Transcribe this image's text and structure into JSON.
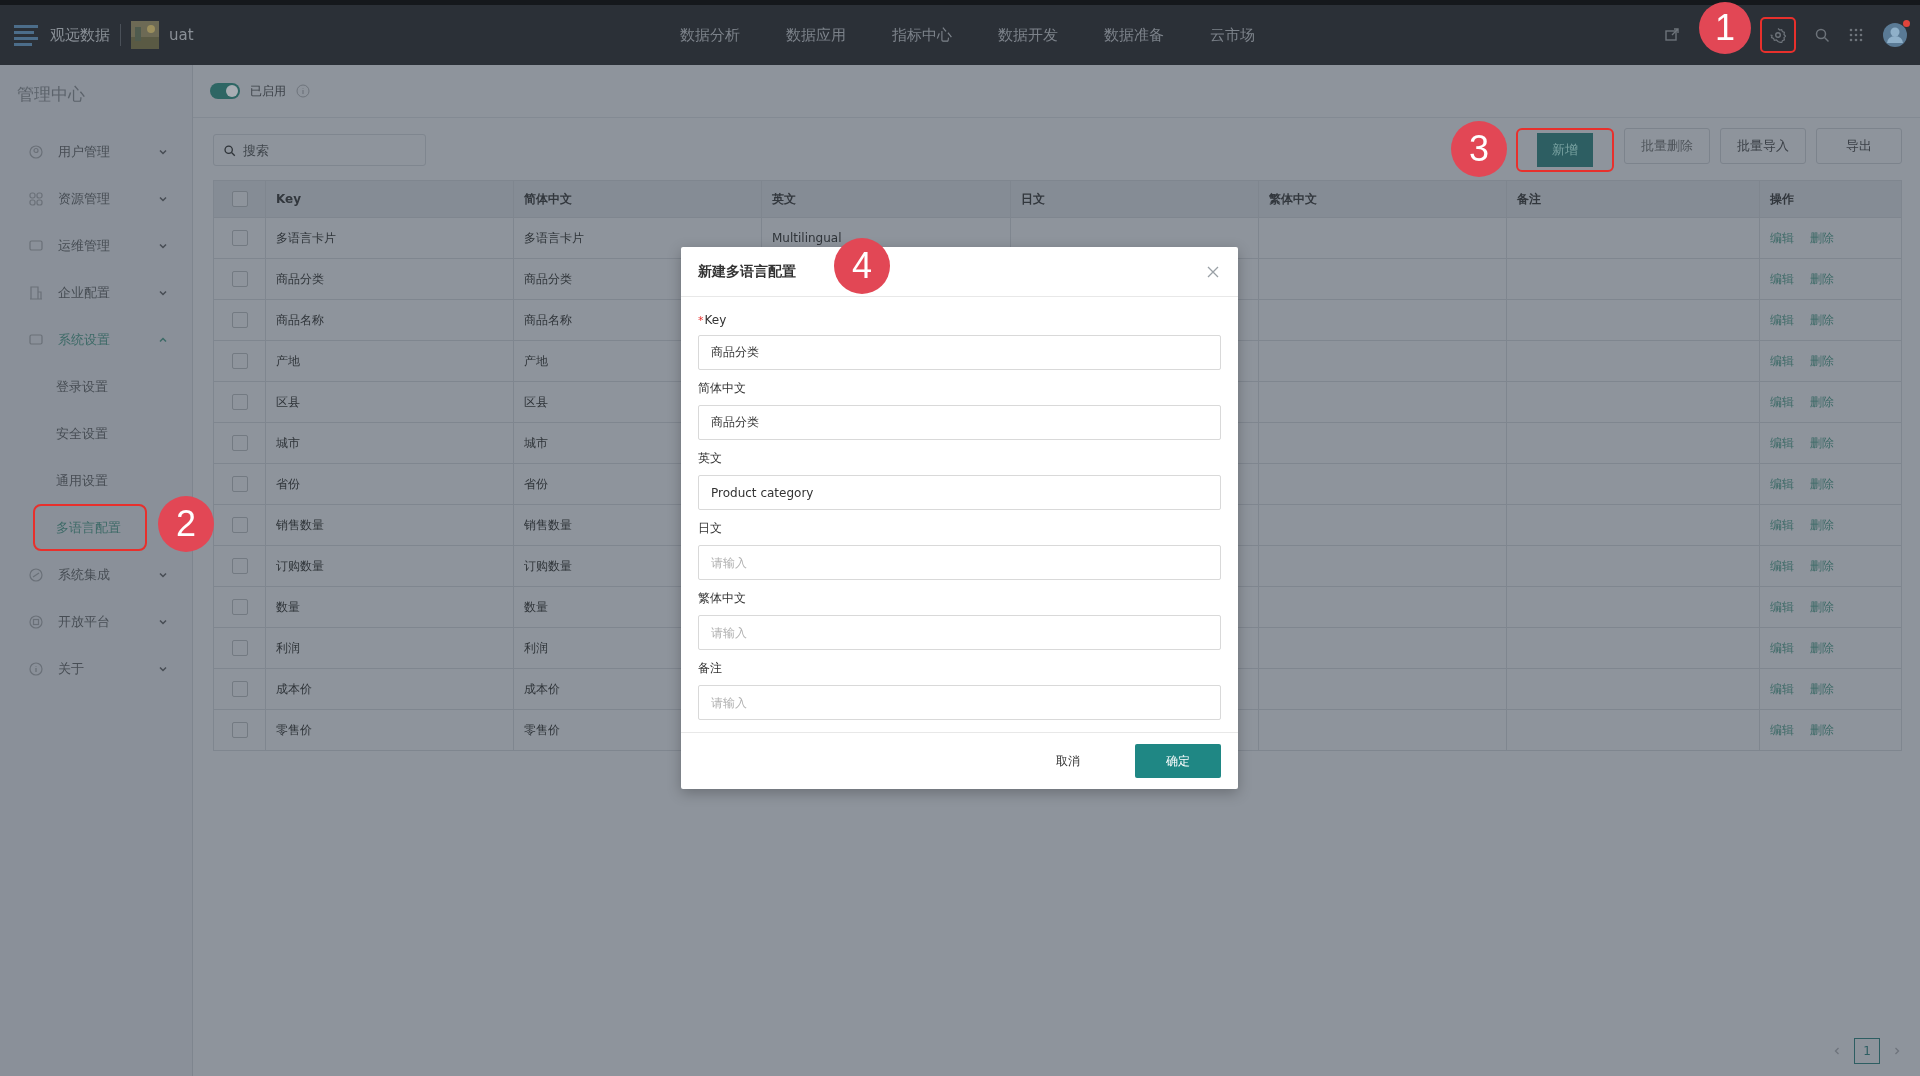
{
  "topbar": {
    "brand": "观远数据",
    "workspace": "uat",
    "nav": [
      {
        "label": "数据分析",
        "selected": false
      },
      {
        "label": "数据应用",
        "selected": false
      },
      {
        "label": "指标中心",
        "selected": false
      },
      {
        "label": "数据开发",
        "selected": false
      },
      {
        "label": "数据准备",
        "selected": false
      },
      {
        "label": "云市场",
        "selected": false
      }
    ],
    "settings_highlighted": true,
    "avatar_notification": true
  },
  "sidebar": {
    "title": "管理中心",
    "items": [
      {
        "label": "用户管理",
        "expanded": false
      },
      {
        "label": "资源管理",
        "expanded": false
      },
      {
        "label": "运维管理",
        "expanded": false
      },
      {
        "label": "企业配置",
        "expanded": false
      },
      {
        "label": "系统设置",
        "expanded": true,
        "children": [
          {
            "label": "登录设置",
            "selected": false,
            "highlighted": false
          },
          {
            "label": "安全设置",
            "selected": false,
            "highlighted": false
          },
          {
            "label": "通用设置",
            "selected": false,
            "highlighted": false
          },
          {
            "label": "多语言配置",
            "selected": true,
            "highlighted": true
          }
        ]
      },
      {
        "label": "系统集成",
        "expanded": false
      },
      {
        "label": "开放平台",
        "expanded": false
      },
      {
        "label": "关于",
        "expanded": false
      }
    ]
  },
  "toggle": {
    "label": "已启用",
    "on": true
  },
  "search": {
    "placeholder": "搜索"
  },
  "buttons": [
    {
      "label": "新增",
      "kind": "primary",
      "disabled": false,
      "highlighted": true
    },
    {
      "label": "批量删除",
      "kind": "default",
      "disabled": true,
      "highlighted": false
    },
    {
      "label": "批量导入",
      "kind": "default",
      "disabled": false,
      "highlighted": false
    },
    {
      "label": "导出",
      "kind": "default",
      "disabled": false,
      "highlighted": false
    }
  ],
  "table": {
    "columns": [
      "Key",
      "简体中文",
      "英文",
      "日文",
      "繁体中文",
      "备注",
      "操作"
    ],
    "all_checked": false,
    "rows": [
      {
        "checked": false,
        "cells": [
          "多语言卡片",
          "多语言卡片",
          "Multilingual",
          "",
          "",
          ""
        ],
        "actions": [
          "编辑",
          "删除"
        ]
      },
      {
        "checked": false,
        "cells": [
          "商品分类",
          "商品分类",
          "",
          "",
          "",
          ""
        ],
        "actions": [
          "编辑",
          "删除"
        ]
      },
      {
        "checked": false,
        "cells": [
          "商品名称",
          "商品名称",
          "",
          "",
          "",
          ""
        ],
        "actions": [
          "编辑",
          "删除"
        ]
      },
      {
        "checked": false,
        "cells": [
          "产地",
          "产地",
          "",
          "",
          "",
          ""
        ],
        "actions": [
          "编辑",
          "删除"
        ]
      },
      {
        "checked": false,
        "cells": [
          "区县",
          "区县",
          "",
          "",
          "",
          ""
        ],
        "actions": [
          "编辑",
          "删除"
        ]
      },
      {
        "checked": false,
        "cells": [
          "城市",
          "城市",
          "",
          "",
          "",
          ""
        ],
        "actions": [
          "编辑",
          "删除"
        ]
      },
      {
        "checked": false,
        "cells": [
          "省份",
          "省份",
          "",
          "",
          "",
          ""
        ],
        "actions": [
          "编辑",
          "删除"
        ]
      },
      {
        "checked": false,
        "cells": [
          "销售数量",
          "销售数量",
          "",
          "",
          "",
          ""
        ],
        "actions": [
          "编辑",
          "删除"
        ]
      },
      {
        "checked": false,
        "cells": [
          "订购数量",
          "订购数量",
          "",
          "",
          "",
          ""
        ],
        "actions": [
          "编辑",
          "删除"
        ]
      },
      {
        "checked": false,
        "cells": [
          "数量",
          "数量",
          "",
          "",
          "",
          ""
        ],
        "actions": [
          "编辑",
          "删除"
        ]
      },
      {
        "checked": false,
        "cells": [
          "利润",
          "利润",
          "",
          "",
          "",
          ""
        ],
        "actions": [
          "编辑",
          "删除"
        ]
      },
      {
        "checked": false,
        "cells": [
          "成本价",
          "成本价",
          "",
          "",
          "",
          ""
        ],
        "actions": [
          "编辑",
          "删除"
        ]
      },
      {
        "checked": false,
        "cells": [
          "零售价",
          "零售价",
          "",
          "",
          "",
          ""
        ],
        "actions": [
          "编辑",
          "删除"
        ]
      }
    ]
  },
  "pagination": {
    "pages": [
      {
        "label": "1",
        "selected": true
      }
    ]
  },
  "modal": {
    "title": "新建多语言配置",
    "fields": [
      {
        "label": "Key",
        "required_mark": "*",
        "value": "商品分类"
      },
      {
        "label": "简体中文",
        "value": "商品分类"
      },
      {
        "label": "英文",
        "value": "Product category"
      },
      {
        "label": "日文",
        "placeholder": "请输入"
      },
      {
        "label": "繁体中文",
        "placeholder": "请输入"
      },
      {
        "label": "备注",
        "placeholder": "请输入"
      }
    ],
    "buttons": [
      {
        "label": "取消",
        "kind": "default"
      },
      {
        "label": "确定",
        "kind": "primary"
      }
    ]
  },
  "annotations": [
    {
      "number": "1"
    },
    {
      "number": "2"
    },
    {
      "number": "3"
    },
    {
      "number": "4"
    }
  ]
}
